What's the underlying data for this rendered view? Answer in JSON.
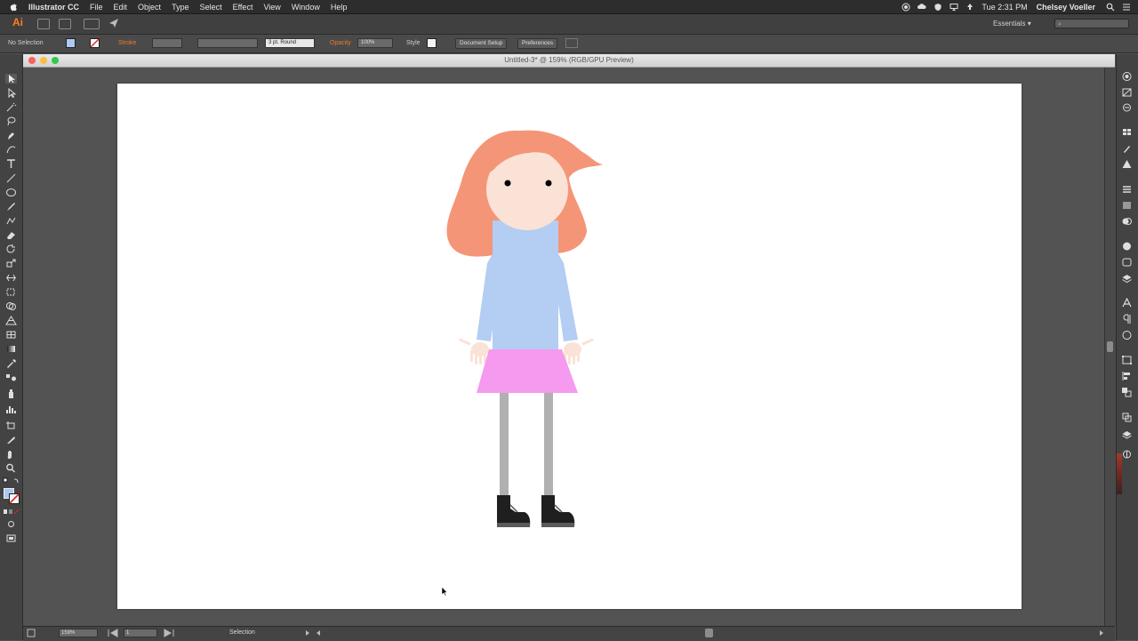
{
  "menubar": {
    "app": "Illustrator CC",
    "items": [
      "File",
      "Edit",
      "Object",
      "Type",
      "Select",
      "Effect",
      "View",
      "Window",
      "Help"
    ],
    "clock": "Tue 2:31 PM",
    "user": "Chelsey Voeller"
  },
  "appbar": {
    "logo": "Ai",
    "workspace": "Essentials",
    "workspace_arrow": "▾",
    "search_icon": "⌕"
  },
  "control": {
    "selection": "No Selection",
    "stroke_label": "Stroke",
    "brush": "3 pt. Round",
    "opacity_label": "Opacity",
    "opacity_value": "100%",
    "style_label": "Style",
    "document_setup": "Document Setup",
    "preferences": "Preferences",
    "fill_color": "#aec8f4"
  },
  "document": {
    "title": "Untitled-3* @ 159% (RGB/GPU Preview)"
  },
  "status": {
    "zoom": "159%",
    "page": "1",
    "tool": "Selection"
  },
  "colors": {
    "hair": "#f59577",
    "skin": "#fbe2d6",
    "shirt": "#b3cdf3",
    "skirt": "#f59aef",
    "legs": "#b0b0b0",
    "shoes": "#1f1f1f",
    "traffic_red": "#fc605b",
    "traffic_yellow": "#fdbc40",
    "traffic_green": "#34c84a"
  }
}
